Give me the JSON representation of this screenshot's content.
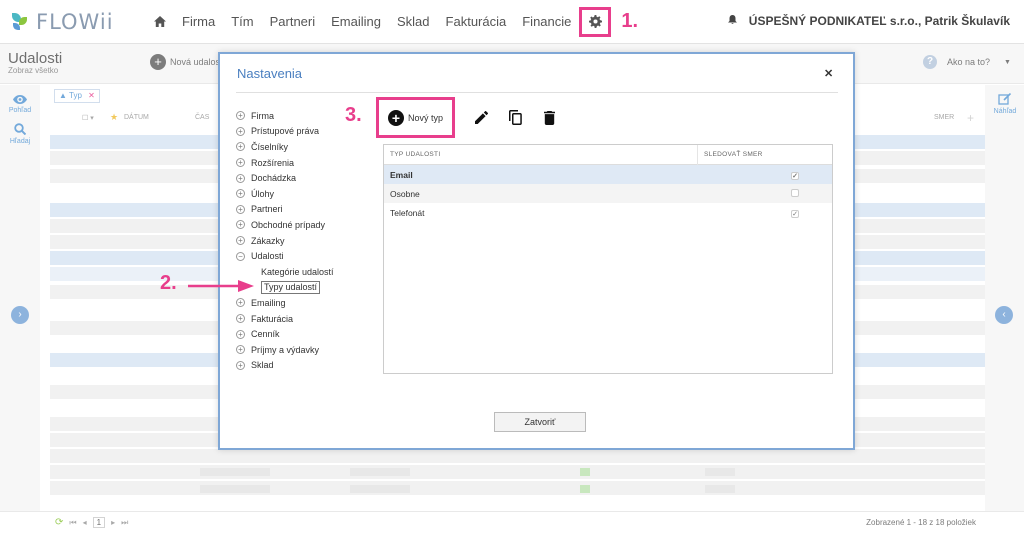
{
  "app": {
    "logo_text": "FLOWii",
    "user": "ÚSPEŠNÝ PODNIKATEĽ s.r.o., Patrik Škulavík"
  },
  "nav": {
    "items": [
      "Firma",
      "Tím",
      "Partneri",
      "Emailing",
      "Sklad",
      "Fakturácia",
      "Financie"
    ]
  },
  "annotations": {
    "step1": "1.",
    "step2": "2.",
    "step3": "3."
  },
  "page": {
    "title": "Udalosti",
    "subtitle": "Zobraz všetko",
    "new_event": "Nová udalos",
    "help": "Ako na to?"
  },
  "sidebar": {
    "view": "Pohľad",
    "search": "Hľadaj",
    "preview": "Náhľad"
  },
  "grid": {
    "filter_chip": "Typ",
    "col_date": "DÁTUM",
    "col_time": "ČAS",
    "col_direction": "SMER"
  },
  "footer": {
    "page": "1",
    "count_text": "Zobrazené 1 - 18 z 18 položiek"
  },
  "modal": {
    "title": "Nastavenia",
    "close_label": "Zatvoriť",
    "new_type_label": "Nový typ",
    "tree": {
      "before": [
        "Firma",
        "Prístupové práva",
        "Číselníky",
        "Rozšírenia",
        "Dochádzka",
        "Úlohy",
        "Partneri",
        "Obchodné prípady",
        "Zákazky"
      ],
      "expanded": "Udalosti",
      "children": [
        "Kategórie udalostí",
        "Typy udalostí"
      ],
      "after": [
        "Emailing",
        "Fakturácia",
        "Cenník",
        "Príjmy a výdavky",
        "Sklad"
      ]
    },
    "table": {
      "headers": [
        "TYP UDALOSTI",
        "SLEDOVAŤ SMER"
      ],
      "rows": [
        {
          "name": "Email",
          "checked": true
        },
        {
          "name": "Osobne",
          "checked": false
        },
        {
          "name": "Telefonát",
          "checked": true
        }
      ]
    }
  },
  "colors": {
    "accent": "#e83e8c",
    "brand_blue": "#4a7fc0",
    "modal_border": "#7fa7d6"
  }
}
